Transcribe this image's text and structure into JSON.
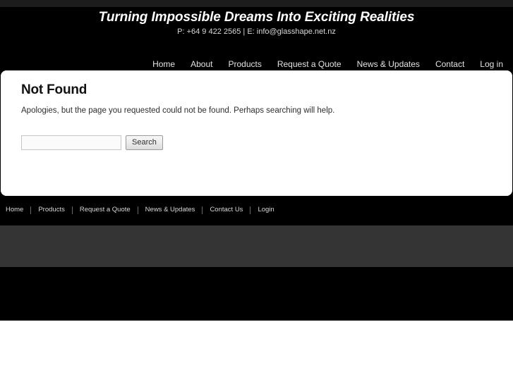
{
  "header": {
    "tagline": "Turning Impossible Dreams Into Exciting Realities",
    "contact": "P: +64 9 422 2565 | E: info@glasshape.net.nz",
    "nav": [
      {
        "label": "Home"
      },
      {
        "label": "About"
      },
      {
        "label": "Products"
      },
      {
        "label": "Request a Quote"
      },
      {
        "label": "News & Updates"
      },
      {
        "label": "Contact"
      },
      {
        "label": "Log in"
      }
    ]
  },
  "main": {
    "title": "Not Found",
    "body": "Apologies, but the page you requested could not be found. Perhaps searching will help.",
    "search": {
      "value": "",
      "placeholder": "",
      "button_label": "Search"
    }
  },
  "footer": {
    "nav": [
      {
        "label": "Home"
      },
      {
        "label": "Products"
      },
      {
        "label": "Request a Quote"
      },
      {
        "label": "News & Updates"
      },
      {
        "label": "Contact Us"
      },
      {
        "label": "Login"
      }
    ]
  },
  "colors": {
    "shell_background": "#000000",
    "top_strip": "#1c1c1c",
    "panel_background": "#ffffff",
    "grey_band": "#343434",
    "nav_text": "#e2e2e2",
    "heading_text": "#111111"
  }
}
